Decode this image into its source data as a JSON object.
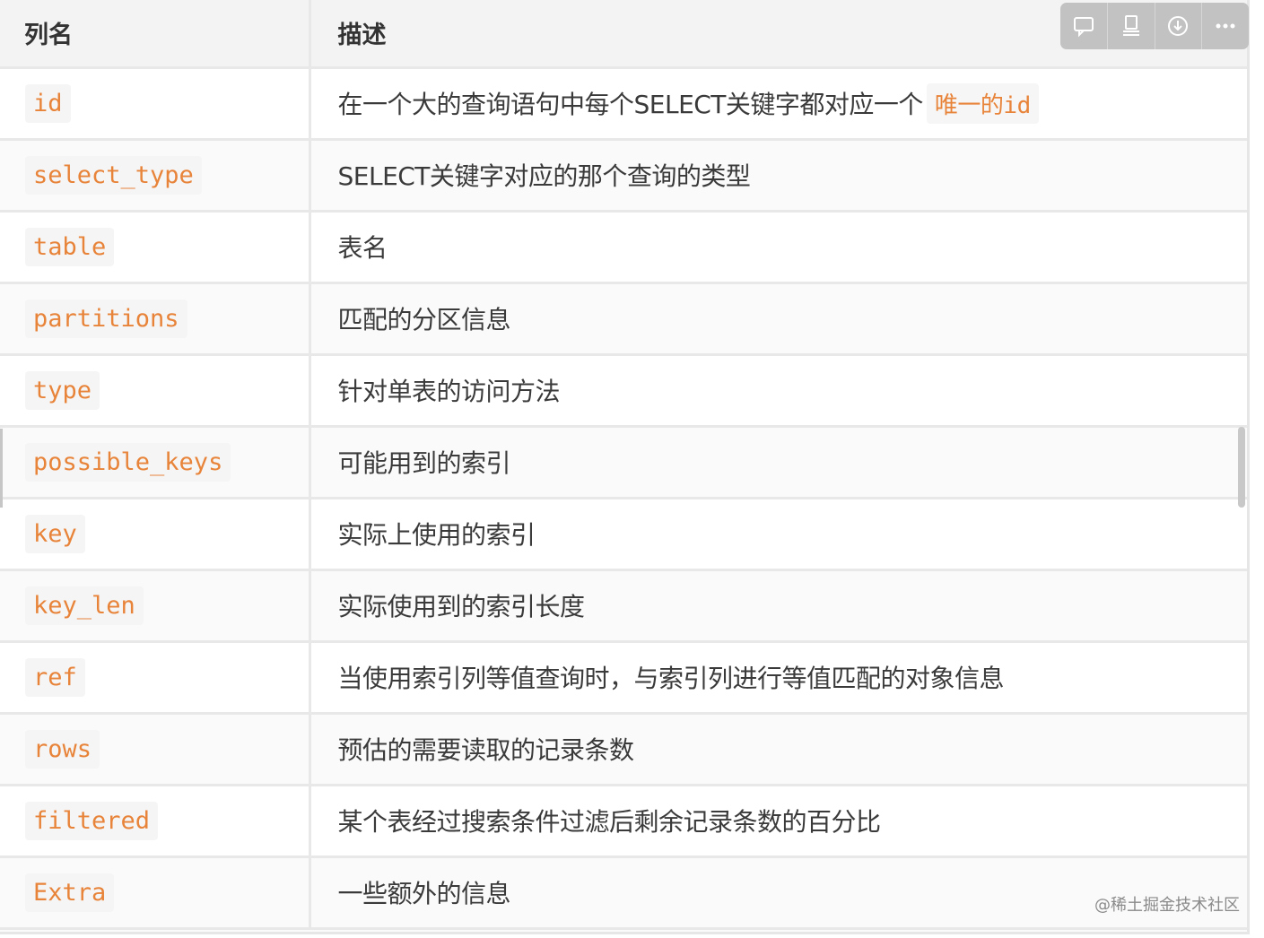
{
  "table": {
    "headers": {
      "name": "列名",
      "description": "描述"
    },
    "rows": [
      {
        "name": "id",
        "description": "在一个大的查询语句中每个SELECT关键字都对应一个",
        "inline_code": "唯一的id"
      },
      {
        "name": "select_type",
        "description": "SELECT关键字对应的那个查询的类型"
      },
      {
        "name": "table",
        "description": "表名"
      },
      {
        "name": "partitions",
        "description": "匹配的分区信息"
      },
      {
        "name": "type",
        "description": "针对单表的访问方法"
      },
      {
        "name": "possible_keys",
        "description": "可能用到的索引"
      },
      {
        "name": "key",
        "description": "实际上使用的索引"
      },
      {
        "name": "key_len",
        "description": "实际使用到的索引长度"
      },
      {
        "name": "ref",
        "description": "当使用索引列等值查询时，与索引列进行等值匹配的对象信息"
      },
      {
        "name": "rows",
        "description": "预估的需要读取的记录条数"
      },
      {
        "name": "filtered",
        "description": "某个表经过搜索条件过滤后剩余记录条数的百分比"
      },
      {
        "name": "Extra",
        "description": "一些额外的信息"
      }
    ]
  },
  "toolbar": {
    "icons": [
      "comment-icon",
      "present-icon",
      "download-icon",
      "more-icon"
    ]
  },
  "watermark": "@稀土掘金技术社区",
  "colors": {
    "code_text": "#e8843a",
    "header_bg": "#f3f3f3",
    "toolbar_bg": "#c2c2c2"
  }
}
